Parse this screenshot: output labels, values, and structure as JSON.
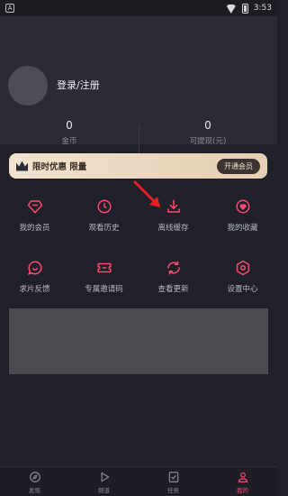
{
  "status_bar": {
    "time": "3:53",
    "left_icon": "A"
  },
  "profile": {
    "login_label": "登录/注册"
  },
  "stats": [
    {
      "value": "0",
      "label": "金币"
    },
    {
      "value": "0",
      "label": "可提现(元)"
    }
  ],
  "vip_card": {
    "text": "限时优惠 限量",
    "button_label": "开通会员"
  },
  "grid": {
    "row1": [
      {
        "label": "我的会员",
        "icon": "diamond-icon"
      },
      {
        "label": "观看历史",
        "icon": "clock-icon"
      },
      {
        "label": "离线缓存",
        "icon": "download-icon"
      },
      {
        "label": "我的收藏",
        "icon": "heart-icon"
      }
    ],
    "row2": [
      {
        "label": "求片反馈",
        "icon": "chat-icon"
      },
      {
        "label": "专属邀请码",
        "icon": "ticket-icon"
      },
      {
        "label": "查看更新",
        "icon": "refresh-icon"
      },
      {
        "label": "设置中心",
        "icon": "settings-icon"
      }
    ]
  },
  "tabbar": [
    {
      "label": "发现",
      "icon": "compass-icon"
    },
    {
      "label": "频道",
      "icon": "play-icon"
    },
    {
      "label": "任务",
      "icon": "task-icon"
    },
    {
      "label": "我的",
      "icon": "user-icon",
      "active": true
    }
  ],
  "colors": {
    "accent": "#ff4a6f",
    "background": "#1f2029",
    "vip_gold": "#f2e2cf"
  }
}
